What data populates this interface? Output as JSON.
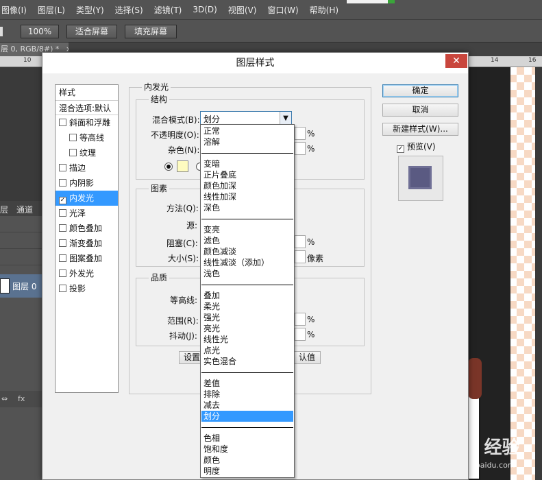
{
  "app": {
    "menu": [
      "图像(I)",
      "图层(L)",
      "类型(Y)",
      "选择(S)",
      "滤镜(T)",
      "3D(D)",
      "视图(V)",
      "窗口(W)",
      "帮助(H)"
    ],
    "options": {
      "zoom": "100%",
      "fit_screen": "适合屏幕",
      "fill_screen": "填充屏幕"
    },
    "doc_tab": "层 0, RGB/8#) *",
    "doc_tab_close": "×",
    "ruler_ticks": [
      "10",
      "14",
      "16"
    ],
    "layers_tabs": [
      "层",
      "通道"
    ],
    "layer_name": "图层 0",
    "layer_bottom": [
      "⇔",
      "fx"
    ],
    "watermark": "Baidu 经验",
    "watermark_sub": "jingyan.baidu.com"
  },
  "dialog": {
    "title": "图层样式",
    "close": "✕",
    "style_list": {
      "header": "样式",
      "blend": "混合选项:默认",
      "items": [
        {
          "label": "斜面和浮雕",
          "checked": false,
          "indent": false
        },
        {
          "label": "等高线",
          "checked": false,
          "indent": true
        },
        {
          "label": "纹理",
          "checked": false,
          "indent": true
        },
        {
          "label": "描边",
          "checked": false,
          "indent": false
        },
        {
          "label": "内阴影",
          "checked": false,
          "indent": false
        },
        {
          "label": "内发光",
          "checked": true,
          "indent": false,
          "selected": true
        },
        {
          "label": "光泽",
          "checked": false,
          "indent": false
        },
        {
          "label": "颜色叠加",
          "checked": false,
          "indent": false
        },
        {
          "label": "渐变叠加",
          "checked": false,
          "indent": false
        },
        {
          "label": "图案叠加",
          "checked": false,
          "indent": false
        },
        {
          "label": "外发光",
          "checked": false,
          "indent": false
        },
        {
          "label": "投影",
          "checked": false,
          "indent": false
        }
      ]
    },
    "inner_glow": {
      "title": "内发光",
      "structure": {
        "title": "结构",
        "blend_mode_label": "混合模式(B):",
        "blend_mode_value": "划分",
        "opacity_label": "不透明度(O):",
        "noise_label": "杂色(N):",
        "percent": "%"
      },
      "elements": {
        "title": "图素",
        "method_label": "方法(Q):",
        "source_label": "源:",
        "choke_label": "阻塞(C):",
        "size_label": "大小(S):",
        "percent": "%",
        "px": "像素"
      },
      "quality": {
        "title": "品质",
        "contour_label": "等高线:",
        "range_label": "范围(R):",
        "jitter_label": "抖动(J):",
        "percent": "%"
      },
      "set_default": "设置",
      "reset_default": "认值"
    },
    "buttons": {
      "ok": "确定",
      "cancel": "取消",
      "new_style": "新建样式(W)...",
      "preview": "预览(V)"
    },
    "dropdown": {
      "groups": [
        [
          "正常",
          "溶解"
        ],
        [
          "变暗",
          "正片叠底",
          "颜色加深",
          "线性加深",
          "深色"
        ],
        [
          "变亮",
          "滤色",
          "颜色减淡",
          "线性减淡（添加）",
          "浅色"
        ],
        [
          "叠加",
          "柔光",
          "强光",
          "亮光",
          "线性光",
          "点光",
          "实色混合"
        ],
        [
          "差值",
          "排除",
          "减去",
          "划分"
        ],
        [
          "色相",
          "饱和度",
          "颜色",
          "明度"
        ]
      ],
      "selected": "划分"
    }
  }
}
